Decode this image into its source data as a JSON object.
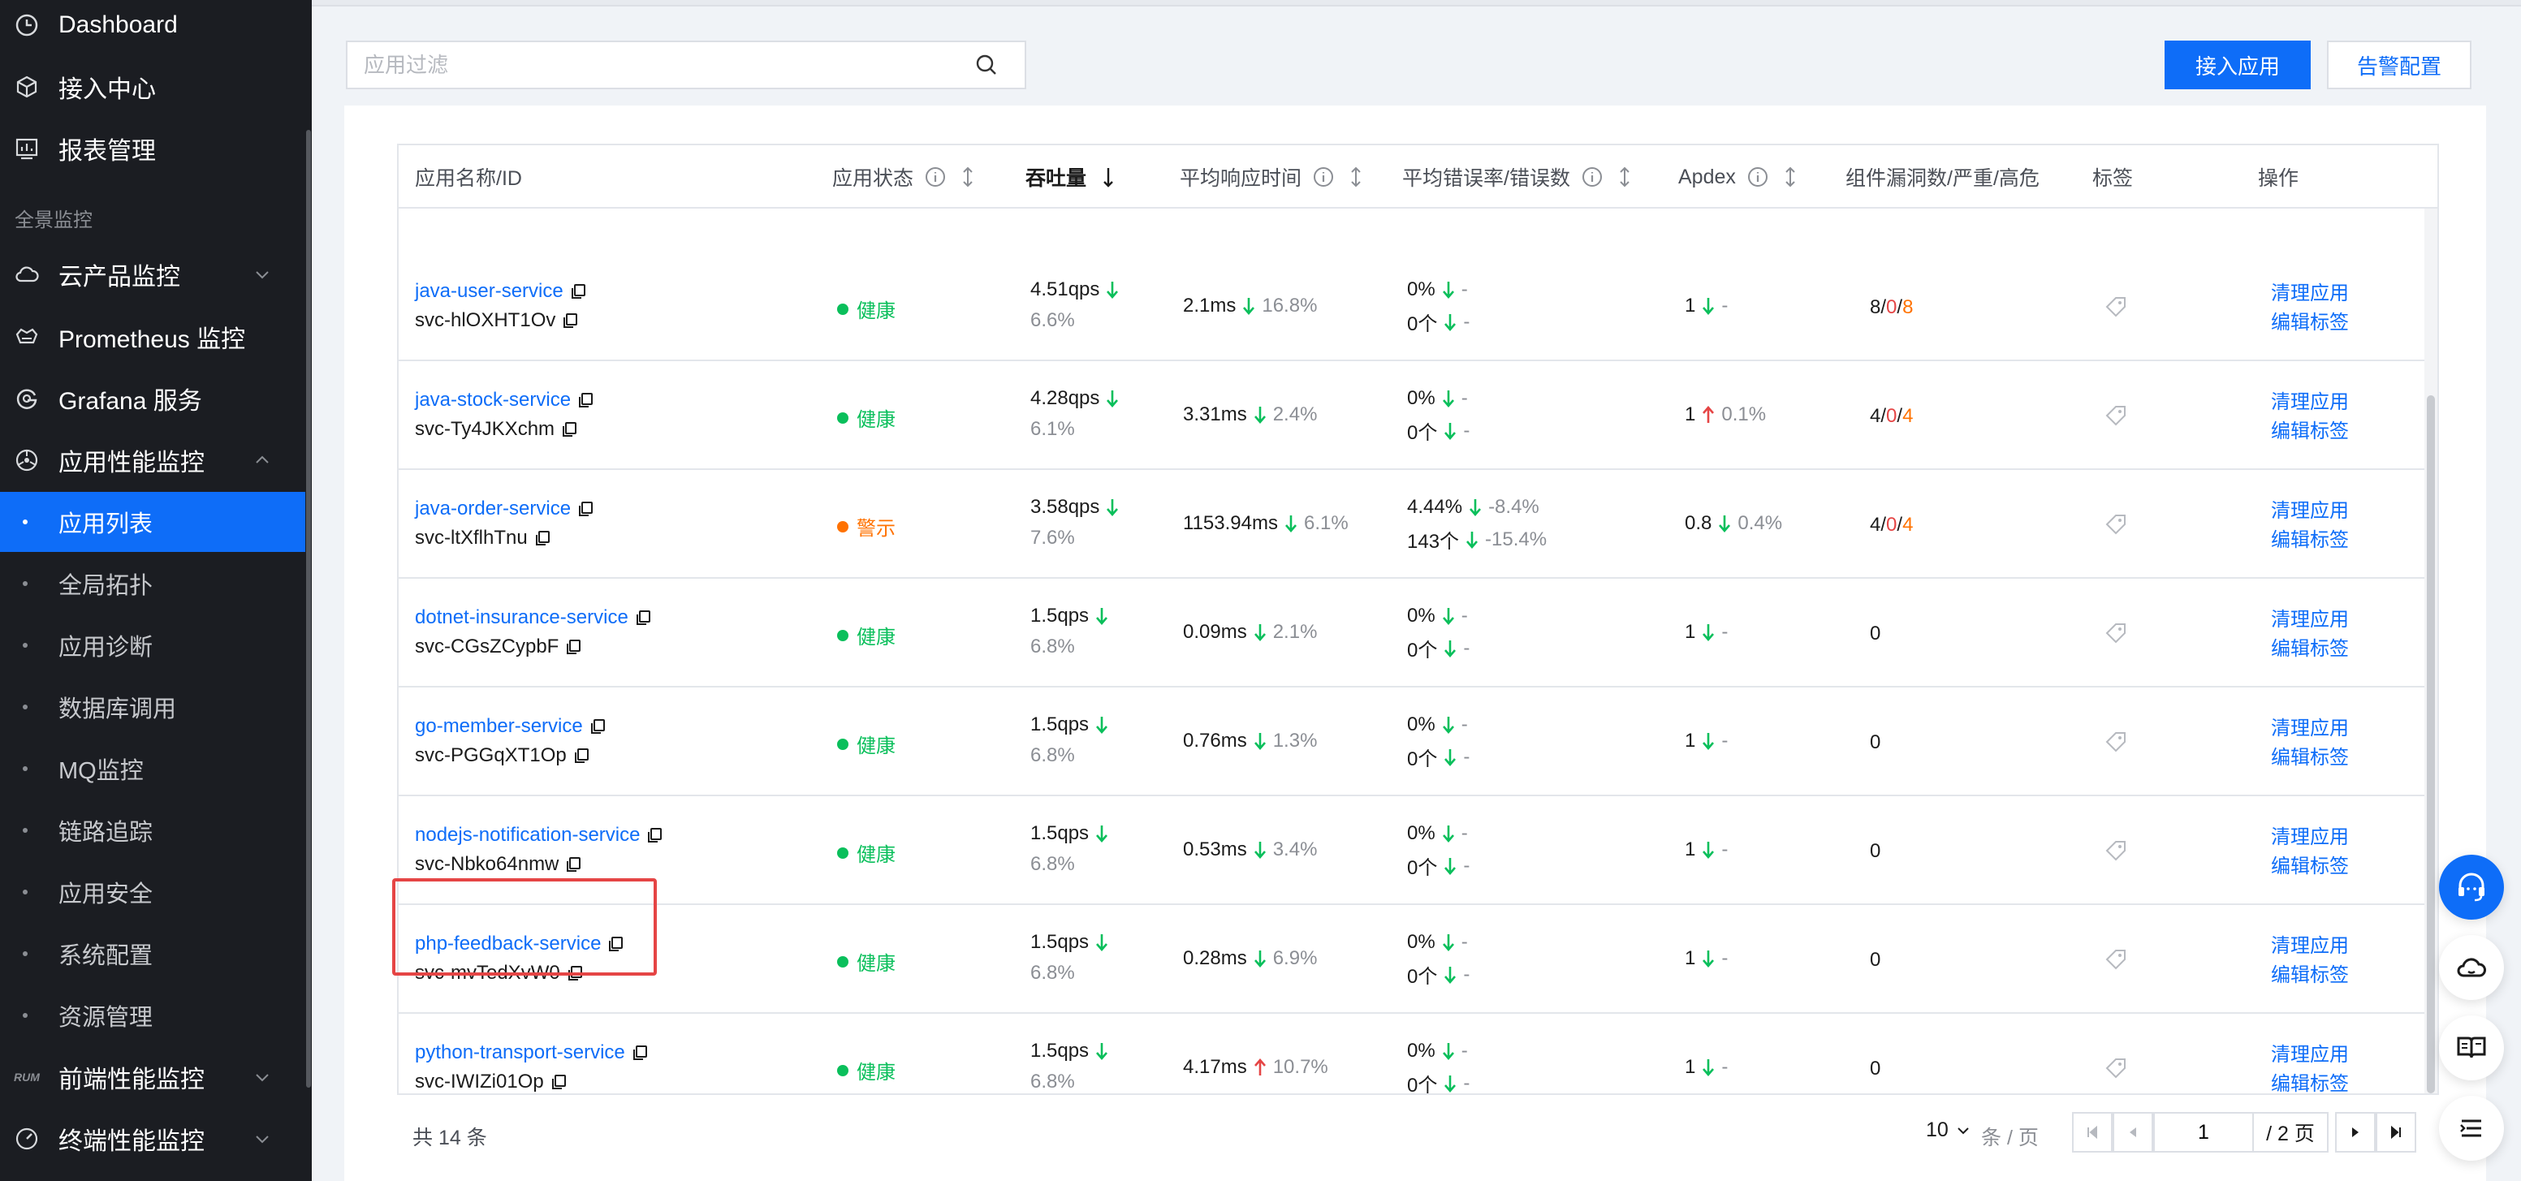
{
  "sidebar": {
    "items": [
      {
        "label": "Dashboard",
        "icon": "dashboard-icon"
      },
      {
        "label": "接入中心",
        "icon": "box-icon"
      },
      {
        "label": "报表管理",
        "icon": "report-icon"
      }
    ],
    "group_label": "全景监控",
    "monitor_items": [
      {
        "label": "云产品监控",
        "icon": "cloud-icon",
        "expanded": false
      },
      {
        "label": "Prometheus 监控",
        "icon": "prometheus-icon"
      },
      {
        "label": "Grafana 服务",
        "icon": "grafana-icon"
      },
      {
        "label": "应用性能监控",
        "icon": "apm-icon",
        "expanded": true
      }
    ],
    "apm_sub": [
      "应用列表",
      "全局拓扑",
      "应用诊断",
      "数据库调用",
      "MQ监控",
      "链路追踪",
      "应用安全",
      "系统配置",
      "资源管理"
    ],
    "active_sub": "应用列表",
    "bottom_items": [
      {
        "label": "前端性能监控",
        "badge": "RUM"
      },
      {
        "label": "终端性能监控",
        "icon": "gauge-icon"
      }
    ]
  },
  "toolbar": {
    "filter_placeholder": "应用过滤",
    "connect_label": "接入应用",
    "alert_label": "告警配置"
  },
  "table": {
    "headers": {
      "name": "应用名称/ID",
      "status": "应用状态",
      "throughput": "吞吐量",
      "latency": "平均响应时间",
      "error": "平均错误率/错误数",
      "apdex": "Apdex",
      "vuln": "组件漏洞数/严重/高危",
      "tags": "标签",
      "ops": "操作"
    },
    "rows": [
      {
        "name": "java-user-service",
        "id": "svc-hlOXHT1Ov",
        "status": "健康",
        "status_type": "ok",
        "qps": "4.51qps",
        "qps_dir": "down",
        "qps_pct": "6.6%",
        "latency": "2.1ms",
        "lat_dir": "down",
        "lat_pct": "16.8%",
        "err_rate": "0%",
        "err_rate_dir": "down",
        "err_rate_pct": "-",
        "err_count": "0个",
        "err_count_dir": "down",
        "err_count_pct": "-",
        "apdex": "1",
        "apdex_dir": "down",
        "apdex_pct": "-",
        "vuln_total": "8",
        "vuln_severe": "0",
        "vuln_high": "8",
        "vuln_has": true
      },
      {
        "name": "java-stock-service",
        "id": "svc-Ty4JKXchm",
        "status": "健康",
        "status_type": "ok",
        "qps": "4.28qps",
        "qps_dir": "down",
        "qps_pct": "6.1%",
        "latency": "3.31ms",
        "lat_dir": "down",
        "lat_pct": "2.4%",
        "err_rate": "0%",
        "err_rate_dir": "down",
        "err_rate_pct": "-",
        "err_count": "0个",
        "err_count_dir": "down",
        "err_count_pct": "-",
        "apdex": "1",
        "apdex_dir": "up",
        "apdex_pct": "0.1%",
        "vuln_total": "4",
        "vuln_severe": "0",
        "vuln_high": "4",
        "vuln_has": true
      },
      {
        "name": "java-order-service",
        "id": "svc-ltXflhTnu",
        "status": "警示",
        "status_type": "warn",
        "qps": "3.58qps",
        "qps_dir": "down",
        "qps_pct": "7.6%",
        "latency": "1153.94ms",
        "lat_dir": "down",
        "lat_pct": "6.1%",
        "err_rate": "4.44%",
        "err_rate_dir": "down",
        "err_rate_pct": "-8.4%",
        "err_count": "143个",
        "err_count_dir": "down",
        "err_count_pct": "-15.4%",
        "apdex": "0.8",
        "apdex_dir": "down",
        "apdex_pct": "0.4%",
        "vuln_total": "4",
        "vuln_severe": "0",
        "vuln_high": "4",
        "vuln_has": true
      },
      {
        "name": "dotnet-insurance-service",
        "id": "svc-CGsZCypbF",
        "status": "健康",
        "status_type": "ok",
        "qps": "1.5qps",
        "qps_dir": "down",
        "qps_pct": "6.8%",
        "latency": "0.09ms",
        "lat_dir": "down",
        "lat_pct": "2.1%",
        "err_rate": "0%",
        "err_rate_dir": "down",
        "err_rate_pct": "-",
        "err_count": "0个",
        "err_count_dir": "down",
        "err_count_pct": "-",
        "apdex": "1",
        "apdex_dir": "down",
        "apdex_pct": "-",
        "vuln_total": "0",
        "vuln_has": false
      },
      {
        "name": "go-member-service",
        "id": "svc-PGGqXT1Op",
        "status": "健康",
        "status_type": "ok",
        "qps": "1.5qps",
        "qps_dir": "down",
        "qps_pct": "6.8%",
        "latency": "0.76ms",
        "lat_dir": "down",
        "lat_pct": "1.3%",
        "err_rate": "0%",
        "err_rate_dir": "down",
        "err_rate_pct": "-",
        "err_count": "0个",
        "err_count_dir": "down",
        "err_count_pct": "-",
        "apdex": "1",
        "apdex_dir": "down",
        "apdex_pct": "-",
        "vuln_total": "0",
        "vuln_has": false
      },
      {
        "name": "nodejs-notification-service",
        "id": "svc-Nbko64nmw",
        "status": "健康",
        "status_type": "ok",
        "qps": "1.5qps",
        "qps_dir": "down",
        "qps_pct": "6.8%",
        "latency": "0.53ms",
        "lat_dir": "down",
        "lat_pct": "3.4%",
        "err_rate": "0%",
        "err_rate_dir": "down",
        "err_rate_pct": "-",
        "err_count": "0个",
        "err_count_dir": "down",
        "err_count_pct": "-",
        "apdex": "1",
        "apdex_dir": "down",
        "apdex_pct": "-",
        "vuln_total": "0",
        "vuln_has": false
      },
      {
        "name": "php-feedback-service",
        "id": "svc-mvTedXvW0",
        "status": "健康",
        "status_type": "ok",
        "qps": "1.5qps",
        "qps_dir": "down",
        "qps_pct": "6.8%",
        "latency": "0.28ms",
        "lat_dir": "down",
        "lat_pct": "6.9%",
        "err_rate": "0%",
        "err_rate_dir": "down",
        "err_rate_pct": "-",
        "err_count": "0个",
        "err_count_dir": "down",
        "err_count_pct": "-",
        "apdex": "1",
        "apdex_dir": "down",
        "apdex_pct": "-",
        "vuln_total": "0",
        "vuln_has": false,
        "highlighted": true
      },
      {
        "name": "python-transport-service",
        "id": "svc-IWIZi01Op",
        "status": "健康",
        "status_type": "ok",
        "qps": "1.5qps",
        "qps_dir": "down",
        "qps_pct": "6.8%",
        "latency": "4.17ms",
        "lat_dir": "up",
        "lat_pct": "10.7%",
        "err_rate": "0%",
        "err_rate_dir": "down",
        "err_rate_pct": "-",
        "err_count": "0个",
        "err_count_dir": "down",
        "err_count_pct": "-",
        "apdex": "1",
        "apdex_dir": "down",
        "apdex_pct": "-",
        "vuln_total": "0",
        "vuln_has": false
      }
    ],
    "op_clean": "清理应用",
    "op_edit_tags": "编辑标签"
  },
  "pagination": {
    "total_text": "共 14 条",
    "page_size": "10",
    "per_page_text": "条 / 页",
    "current_page": "1",
    "total_pages_text": "/ 2 页"
  },
  "colors": {
    "accent": "#0e6df8",
    "ok": "#0abf5b",
    "warn": "#ff7200",
    "up_arrow": "#e54545"
  }
}
